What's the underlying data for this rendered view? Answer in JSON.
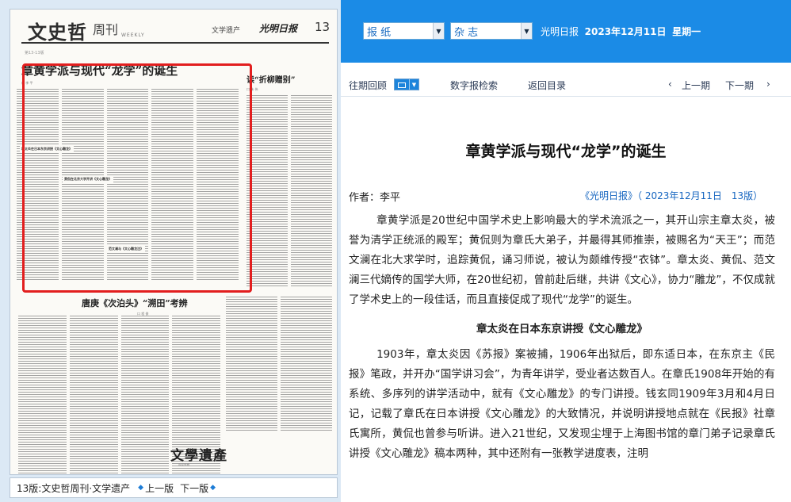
{
  "newspaper_page": {
    "masthead_title": "文史哲",
    "masthead_subtitle": "周刊",
    "masthead_weekly": "WEEKLY",
    "masthead_section": "文学遗产",
    "masthead_brand": "光明日报",
    "masthead_page_num": "13",
    "page_stamp": "第13-13版",
    "main_article_title": "章黄学派与现代“龙学”的诞生",
    "main_article_author": "口 李 平",
    "main_subhead_1": "章太炎在日本东京讲授《文心雕龙》",
    "main_subhead_2": "黄侃在北京大学开讲《文心雕龙》",
    "main_subhead_3": "范文澜与《文心雕龙注》",
    "right_article_title": "读“折柳赠别”",
    "right_article_author": "口 朱 伟",
    "mid_article_title": "唐庚《次泊头》“溯田”考辨",
    "mid_article_author": "口 程 俊",
    "deco_stamp": "文學遺產",
    "deco_caption": "欢迎来稿"
  },
  "page_nav": {
    "edition": "13版:文史哲周刊·文学遗产",
    "prev": "上一版",
    "next": "下一版"
  },
  "top_bar": {
    "paper_select": "报  纸",
    "magazine_select": "杂  志",
    "paper_name": "光明日报",
    "date": "2023年12月11日",
    "weekday": "星期一"
  },
  "toolbar": {
    "history": "往期回顾",
    "search": "数字报检索",
    "back_to_index": "返回目录",
    "prev_issue": "上一期",
    "next_issue": "下一期"
  },
  "article": {
    "title": "章黄学派与现代“龙学”的诞生",
    "author": "作者：李平",
    "source": "《光明日报》（ 2023年12月11日　13版）",
    "para1": "章黄学派是20世纪中国学术史上影响最大的学术流派之一，其开山宗主章太炎，被誉为清学正统派的殿军；黄侃则为章氏大弟子，并最得其师推崇，被赐名为“天王”；而范文澜在北大求学时，追踪黄侃，诵习师说，被认为颇维传授“衣钵”。章太炎、黄侃、范文澜三代嫡传的国学大师，在20世纪初，曾前赴后继，共讲《文心》，协力“雕龙”，不仅成就了学术史上的一段佳话，而且直接促成了现代“龙学”的诞生。",
    "subheading": "章太炎在日本东京讲授《文心雕龙》",
    "para2": "1903年，章太炎因《苏报》案被捕，1906年出狱后，即东适日本，在东京主《民报》笔政，并开办“国学讲习会”，为青年讲学，受业者达数百人。在章氏1908年开始的有系统、多序列的讲学活动中，就有《文心雕龙》的专门讲授。钱玄同1909年3月和4月日记，记载了章氏在日本讲授《文心雕龙》的大致情况，并说明讲授地点就在《民报》社章氏寓所，黄侃也曾参与听讲。进入21世纪，又发现尘埋于上海图书馆的章门弟子记录章氏讲授《文心雕龙》稿本两种，其中还附有一张教学进度表，注明"
  },
  "colors": {
    "top_bar_blue": "#1b8be6",
    "left_panel_bg": "#dce9f5",
    "highlight_red": "#e21e1e",
    "link_blue": "#1565c0"
  }
}
